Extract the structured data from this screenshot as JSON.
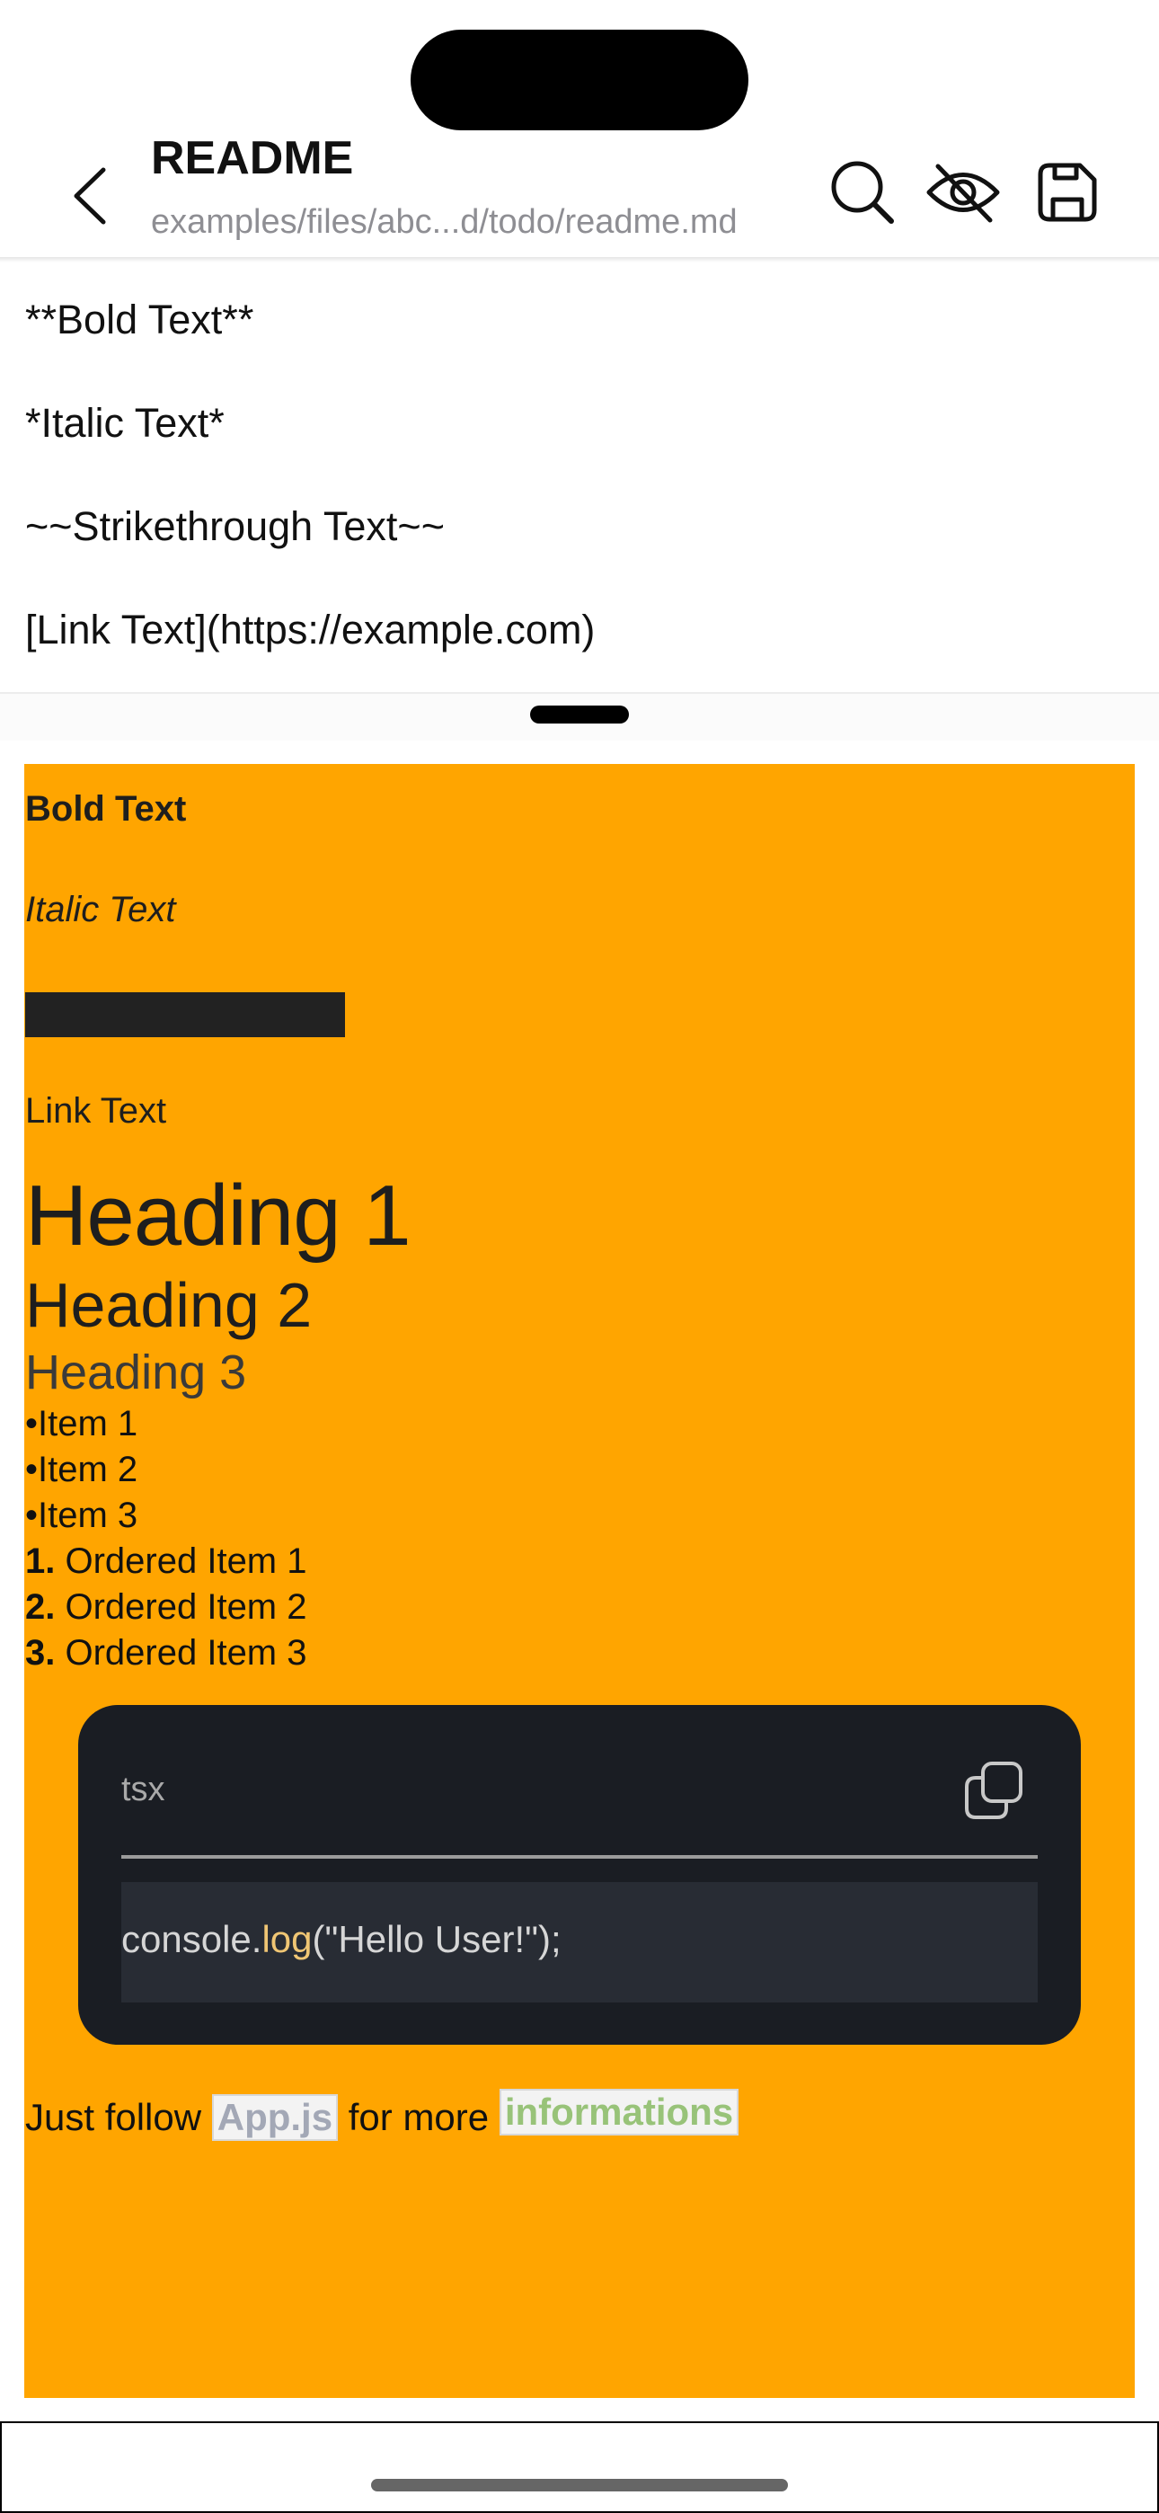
{
  "header": {
    "title": "README",
    "path": "examples/files/abc...d/todo/readme.md"
  },
  "editor": {
    "lines": [
      "**Bold Text**",
      "*Italic Text*",
      "~~Strikethrough Text~~",
      "[Link Text](https://example.com)"
    ]
  },
  "preview": {
    "bold": "Bold Text",
    "italic": "Italic Text",
    "link": "Link Text",
    "h1": "Heading 1",
    "h2": "Heading 2",
    "h3": "Heading 3",
    "list": [
      "Item 1",
      "Item 2",
      "Item 3"
    ],
    "bullet": "•",
    "ordered": [
      {
        "num": "1.",
        "label": "Ordered Item 1"
      },
      {
        "num": "2.",
        "label": "Ordered Item 2"
      },
      {
        "num": "3.",
        "label": "Ordered Item 3"
      }
    ],
    "code": {
      "lang": "tsx",
      "obj": "console.",
      "fn": "log",
      "args": "(\"Hello User!\");"
    },
    "follow": {
      "pre": "Just follow ",
      "code1": "App.js",
      "mid": " for more ",
      "code2": "informations"
    }
  },
  "colors": {
    "preview_bg": "#ffa500",
    "code_bg": "#1a1d23",
    "code_fn": "#f0c674",
    "inline_code_green": "#98c379"
  },
  "icons": [
    "back-chevron-icon",
    "search-icon",
    "eye-off-icon",
    "save-icon",
    "copy-icon"
  ]
}
